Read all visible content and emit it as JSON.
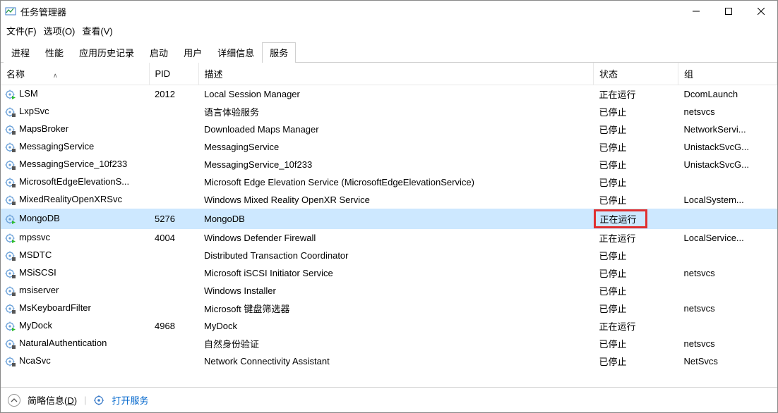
{
  "window": {
    "title": "任务管理器",
    "minimize": "—",
    "maximize": "☐",
    "close": "✕"
  },
  "menubar": {
    "file": "文件(F)",
    "options": "选项(O)",
    "view": "查看(V)"
  },
  "tabs": {
    "processes": "进程",
    "performance": "性能",
    "app_history": "应用历史记录",
    "startup": "启动",
    "users": "用户",
    "details": "详细信息",
    "services": "服务"
  },
  "columns": {
    "name": "名称",
    "pid": "PID",
    "description": "描述",
    "status": "状态",
    "group": "组"
  },
  "rows": [
    {
      "name": "LSM",
      "pid": "2012",
      "description": "Local Session Manager",
      "status": "正在运行",
      "group": "DcomLaunch",
      "running": true
    },
    {
      "name": "LxpSvc",
      "pid": "",
      "description": "语言体验服务",
      "status": "已停止",
      "group": "netsvcs",
      "running": false
    },
    {
      "name": "MapsBroker",
      "pid": "",
      "description": "Downloaded Maps Manager",
      "status": "已停止",
      "group": "NetworkServi...",
      "running": false
    },
    {
      "name": "MessagingService",
      "pid": "",
      "description": "MessagingService",
      "status": "已停止",
      "group": "UnistackSvcG...",
      "running": false
    },
    {
      "name": "MessagingService_10f233",
      "pid": "",
      "description": "MessagingService_10f233",
      "status": "已停止",
      "group": "UnistackSvcG...",
      "running": false
    },
    {
      "name": "MicrosoftEdgeElevationS...",
      "pid": "",
      "description": "Microsoft Edge Elevation Service (MicrosoftEdgeElevationService)",
      "status": "已停止",
      "group": "",
      "running": false
    },
    {
      "name": "MixedRealityOpenXRSvc",
      "pid": "",
      "description": "Windows Mixed Reality OpenXR Service",
      "status": "已停止",
      "group": "LocalSystem...",
      "running": false
    },
    {
      "name": "MongoDB",
      "pid": "5276",
      "description": "MongoDB",
      "status": "正在运行",
      "group": "",
      "running": true,
      "selected": true,
      "highlight_status": true
    },
    {
      "name": "mpssvc",
      "pid": "4004",
      "description": "Windows Defender Firewall",
      "status": "正在运行",
      "group": "LocalService...",
      "running": true
    },
    {
      "name": "MSDTC",
      "pid": "",
      "description": "Distributed Transaction Coordinator",
      "status": "已停止",
      "group": "",
      "running": false
    },
    {
      "name": "MSiSCSI",
      "pid": "",
      "description": "Microsoft iSCSI Initiator Service",
      "status": "已停止",
      "group": "netsvcs",
      "running": false
    },
    {
      "name": "msiserver",
      "pid": "",
      "description": "Windows Installer",
      "status": "已停止",
      "group": "",
      "running": false
    },
    {
      "name": "MsKeyboardFilter",
      "pid": "",
      "description": "Microsoft 键盘筛选器",
      "status": "已停止",
      "group": "netsvcs",
      "running": false
    },
    {
      "name": "MyDock",
      "pid": "4968",
      "description": "MyDock",
      "status": "正在运行",
      "group": "",
      "running": true
    },
    {
      "name": "NaturalAuthentication",
      "pid": "",
      "description": "自然身份验证",
      "status": "已停止",
      "group": "netsvcs",
      "running": false
    },
    {
      "name": "NcaSvc",
      "pid": "",
      "description": "Network Connectivity Assistant",
      "status": "已停止",
      "group": "NetSvcs",
      "running": false
    }
  ],
  "statusbar": {
    "fewer_details_pre": "简略信息(",
    "fewer_details_hotkey": "D",
    "fewer_details_post": ")",
    "open_services": "打开服务"
  }
}
